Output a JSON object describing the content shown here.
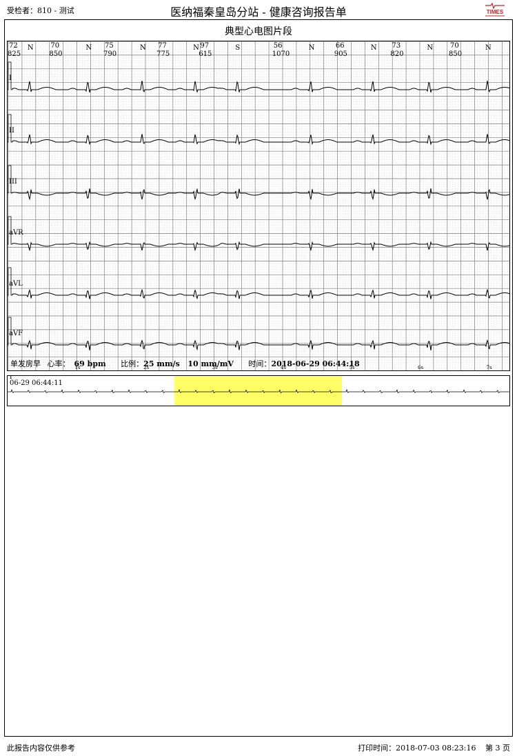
{
  "header": {
    "patient": "受检者：810 - 测试",
    "title": "医纳福秦皇岛分站 - 健康咨询报告单",
    "logo_text": "TIMES"
  },
  "section_title": "典型心电图片段",
  "beats": [
    {
      "hr": "72",
      "rr": "825",
      "type": "N"
    },
    {
      "hr": "70",
      "rr": "850",
      "type": "N"
    },
    {
      "hr": "75",
      "rr": "790",
      "type": "N"
    },
    {
      "hr": "77",
      "rr": "775",
      "type": "N"
    },
    {
      "hr": "97",
      "rr": "615",
      "type": "S"
    },
    {
      "hr": "56",
      "rr": "1070",
      "type": "N"
    },
    {
      "hr": "66",
      "rr": "905",
      "type": "N"
    },
    {
      "hr": "73",
      "rr": "820",
      "type": "N"
    },
    {
      "hr": "70",
      "rr": "850",
      "type": "N"
    }
  ],
  "leads": [
    "I",
    "II",
    "III",
    "aVR",
    "aVL",
    "aVF"
  ],
  "info": {
    "diagnosis": "单发房早",
    "hr_label": "心率：",
    "hr_value": "69 bpm",
    "scale_label": "比例：",
    "speed": "25 mm/s",
    "gain": "10 mm/mV",
    "time_label": "时间：",
    "time_value": "2018-06-29 06:44:18"
  },
  "seconds": [
    "1s",
    "2s",
    "3s",
    "4s",
    "5s",
    "6s",
    "7s"
  ],
  "strip": {
    "lead": "I",
    "start_time": "06-29 06:44:11",
    "highlight_color": "#ffff66"
  },
  "footer": {
    "disclaimer": "此报告内容仅供参考",
    "print_label": "打印时间：",
    "print_time": "2018-07-03  08:23:16",
    "page": "第 3 页"
  },
  "colors": {
    "grid_major": "#7a7a7a",
    "grid_minor": "#c8c8c8",
    "trace": "#000000",
    "logo": "#cc1f1f"
  }
}
